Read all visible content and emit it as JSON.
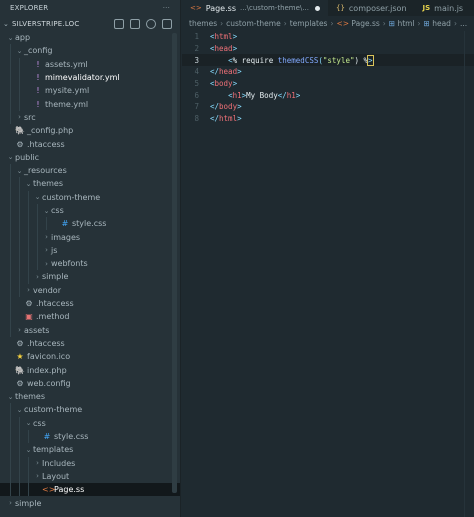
{
  "explorer": {
    "title": "EXPLORER",
    "more": "···",
    "root": "SILVERSTRIPE.LOC",
    "items": [
      {
        "label": "app",
        "depth": 0,
        "chev": "⌄",
        "icon": "",
        "icon_name": "",
        "color": ""
      },
      {
        "label": "_config",
        "depth": 1,
        "chev": "⌄",
        "icon": "",
        "icon_name": "",
        "color": ""
      },
      {
        "label": "assets.yml",
        "depth": 2,
        "chev": "",
        "icon": "!",
        "icon_name": "yaml-icon",
        "color": "#c792ea"
      },
      {
        "label": "mimevalidator.yml",
        "depth": 2,
        "chev": "",
        "icon": "!",
        "icon_name": "yaml-icon",
        "color": "#c792ea",
        "bold": true
      },
      {
        "label": "mysite.yml",
        "depth": 2,
        "chev": "",
        "icon": "!",
        "icon_name": "yaml-icon",
        "color": "#c792ea"
      },
      {
        "label": "theme.yml",
        "depth": 2,
        "chev": "",
        "icon": "!",
        "icon_name": "yaml-icon",
        "color": "#c792ea"
      },
      {
        "label": "src",
        "depth": 1,
        "chev": "›",
        "icon": "",
        "icon_name": "",
        "color": ""
      },
      {
        "label": "_config.php",
        "depth": 0,
        "chev": "",
        "icon": "🐘",
        "icon_name": "php-icon",
        "color": "#8892bf"
      },
      {
        "label": ".htaccess",
        "depth": 0,
        "chev": "",
        "icon": "⚙",
        "icon_name": "gear-icon",
        "color": "#a9b7be"
      },
      {
        "label": "public",
        "depth": 0,
        "chev": "⌄",
        "icon": "",
        "icon_name": "",
        "color": ""
      },
      {
        "label": "_resources",
        "depth": 1,
        "chev": "⌄",
        "icon": "",
        "icon_name": "",
        "color": ""
      },
      {
        "label": "themes",
        "depth": 2,
        "chev": "⌄",
        "icon": "",
        "icon_name": "",
        "color": ""
      },
      {
        "label": "custom-theme",
        "depth": 3,
        "chev": "⌄",
        "icon": "",
        "icon_name": "",
        "color": ""
      },
      {
        "label": "css",
        "depth": 4,
        "chev": "⌄",
        "icon": "",
        "icon_name": "",
        "color": ""
      },
      {
        "label": "style.css",
        "depth": 5,
        "chev": "",
        "icon": "#",
        "icon_name": "css-icon",
        "color": "#42a5f5"
      },
      {
        "label": "images",
        "depth": 4,
        "chev": "›",
        "icon": "",
        "icon_name": "",
        "color": ""
      },
      {
        "label": "js",
        "depth": 4,
        "chev": "›",
        "icon": "",
        "icon_name": "",
        "color": ""
      },
      {
        "label": "webfonts",
        "depth": 4,
        "chev": "›",
        "icon": "",
        "icon_name": "",
        "color": ""
      },
      {
        "label": "simple",
        "depth": 3,
        "chev": "›",
        "icon": "",
        "icon_name": "",
        "color": ""
      },
      {
        "label": "vendor",
        "depth": 2,
        "chev": "›",
        "icon": "",
        "icon_name": "",
        "color": ""
      },
      {
        "label": ".htaccess",
        "depth": 1,
        "chev": "",
        "icon": "⚙",
        "icon_name": "gear-icon",
        "color": "#a9b7be"
      },
      {
        "label": ".method",
        "depth": 1,
        "chev": "",
        "icon": "▣",
        "icon_name": "file-icon",
        "color": "#e57373"
      },
      {
        "label": "assets",
        "depth": 1,
        "chev": "›",
        "icon": "",
        "icon_name": "",
        "color": ""
      },
      {
        "label": ".htaccess",
        "depth": 0,
        "chev": "",
        "icon": "⚙",
        "icon_name": "gear-icon",
        "color": "#a9b7be"
      },
      {
        "label": "favicon.ico",
        "depth": 0,
        "chev": "",
        "icon": "★",
        "icon_name": "star-icon",
        "color": "#f4d03f"
      },
      {
        "label": "index.php",
        "depth": 0,
        "chev": "",
        "icon": "🐘",
        "icon_name": "php-icon",
        "color": "#8892bf"
      },
      {
        "label": "web.config",
        "depth": 0,
        "chev": "",
        "icon": "⚙",
        "icon_name": "gear-icon",
        "color": "#a9b7be"
      },
      {
        "label": "themes",
        "depth": 0,
        "chev": "⌄",
        "icon": "",
        "icon_name": "",
        "color": ""
      },
      {
        "label": "custom-theme",
        "depth": 1,
        "chev": "⌄",
        "icon": "",
        "icon_name": "",
        "color": ""
      },
      {
        "label": "css",
        "depth": 2,
        "chev": "⌄",
        "icon": "",
        "icon_name": "",
        "color": ""
      },
      {
        "label": "style.css",
        "depth": 3,
        "chev": "",
        "icon": "#",
        "icon_name": "css-icon",
        "color": "#42a5f5"
      },
      {
        "label": "templates",
        "depth": 2,
        "chev": "⌄",
        "icon": "",
        "icon_name": "",
        "color": ""
      },
      {
        "label": "Includes",
        "depth": 3,
        "chev": "›",
        "icon": "",
        "icon_name": "",
        "color": ""
      },
      {
        "label": "Layout",
        "depth": 3,
        "chev": "›",
        "icon": "",
        "icon_name": "",
        "color": ""
      },
      {
        "label": "Page.ss",
        "depth": 3,
        "chev": "",
        "icon": "<>",
        "icon_name": "template-icon",
        "color": "#e07a42",
        "selected": true
      },
      {
        "label": "simple",
        "depth": 0,
        "chev": "›",
        "icon": "",
        "icon_name": "",
        "color": ""
      }
    ]
  },
  "tabs": [
    {
      "label": "Page.ss",
      "sub": "...\\custom-theme\\...",
      "icon": "<>",
      "icon_class": "",
      "icon_name": "template-icon",
      "active": true,
      "dirty": true
    },
    {
      "label": "composer.json",
      "sub": "",
      "icon": "{}",
      "icon_class": "json",
      "icon_name": "json-icon",
      "active": false,
      "dirty": false
    },
    {
      "label": "main.js",
      "sub": "",
      "icon": "JS",
      "icon_class": "js",
      "icon_name": "js-icon",
      "active": false,
      "dirty": false
    }
  ],
  "breadcrumbs": [
    {
      "label": "themes",
      "icon": "",
      "icon_class": "",
      "icon_name": ""
    },
    {
      "label": "custom-theme",
      "icon": "",
      "icon_class": "",
      "icon_name": ""
    },
    {
      "label": "templates",
      "icon": "",
      "icon_class": "",
      "icon_name": ""
    },
    {
      "label": "Page.ss",
      "icon": "<>",
      "icon_class": "",
      "icon_name": "template-icon"
    },
    {
      "label": "html",
      "icon": "⊞",
      "icon_class": "tag",
      "icon_name": "tag-icon"
    },
    {
      "label": "head",
      "icon": "⊞",
      "icon_class": "tag",
      "icon_name": "tag-icon"
    },
    {
      "label": "...",
      "icon": "",
      "icon_class": "",
      "icon_name": ""
    }
  ],
  "code": {
    "current_line": 3,
    "lines": [
      {
        "n": "1",
        "tokens": [
          {
            "t": "<",
            "c": "br"
          },
          {
            "t": "html",
            "c": "tg"
          },
          {
            "t": ">",
            "c": "br"
          }
        ]
      },
      {
        "n": "2",
        "tokens": [
          {
            "t": "<",
            "c": "br"
          },
          {
            "t": "head",
            "c": "tg"
          },
          {
            "t": ">",
            "c": "br"
          }
        ]
      },
      {
        "n": "3",
        "tokens": [
          {
            "t": "    ",
            "c": "src"
          },
          {
            "t": "<",
            "c": "br"
          },
          {
            "t": "% require ",
            "c": "kw"
          },
          {
            "t": "themedCSS",
            "c": "fn"
          },
          {
            "t": "(",
            "c": "br"
          },
          {
            "t": "\"style\"",
            "c": "st"
          },
          {
            "t": ") %",
            "c": "kw"
          },
          {
            "t": ">",
            "c": "br"
          }
        ]
      },
      {
        "n": "4",
        "tokens": [
          {
            "t": "</",
            "c": "br"
          },
          {
            "t": "head",
            "c": "tg"
          },
          {
            "t": ">",
            "c": "br"
          }
        ]
      },
      {
        "n": "5",
        "tokens": [
          {
            "t": "<",
            "c": "br"
          },
          {
            "t": "body",
            "c": "tg"
          },
          {
            "t": ">",
            "c": "br"
          }
        ]
      },
      {
        "n": "6",
        "tokens": [
          {
            "t": "    ",
            "c": "src"
          },
          {
            "t": "<",
            "c": "br"
          },
          {
            "t": "h1",
            "c": "tg"
          },
          {
            "t": ">",
            "c": "br"
          },
          {
            "t": "My Body",
            "c": "src"
          },
          {
            "t": "</",
            "c": "br"
          },
          {
            "t": "h1",
            "c": "tg"
          },
          {
            "t": ">",
            "c": "br"
          }
        ]
      },
      {
        "n": "7",
        "tokens": [
          {
            "t": "</",
            "c": "br"
          },
          {
            "t": "body",
            "c": "tg"
          },
          {
            "t": ">",
            "c": "br"
          }
        ]
      },
      {
        "n": "8",
        "tokens": [
          {
            "t": "</",
            "c": "br"
          },
          {
            "t": "html",
            "c": "tg"
          },
          {
            "t": ">",
            "c": "br"
          }
        ]
      }
    ]
  }
}
